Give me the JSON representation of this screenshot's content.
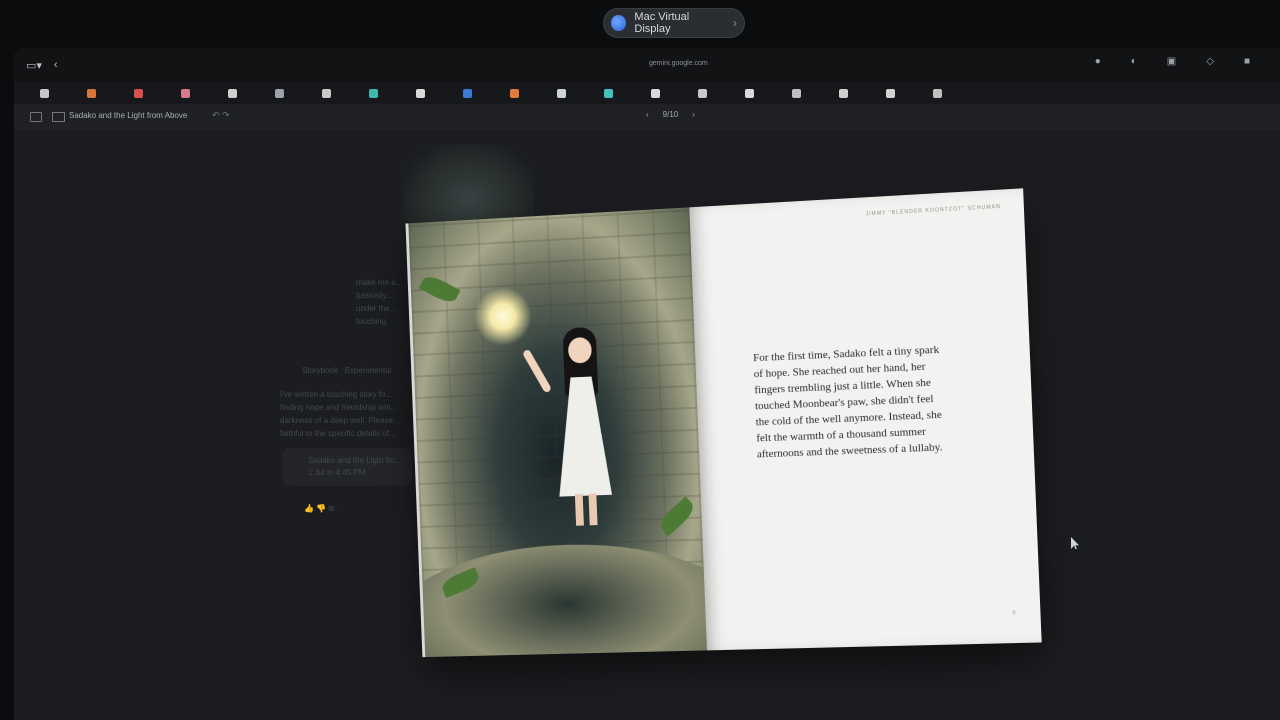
{
  "virtual_display": {
    "label": "Mac Virtual Display",
    "chevron": "›"
  },
  "browser": {
    "url": "gemini.google.com",
    "nav_back": "‹",
    "right_icons": [
      "●",
      "◐",
      "▣",
      "◇",
      "■"
    ],
    "bookmark_colors": [
      "#c7c7c7",
      "#d7763a",
      "#d94f4f",
      "#d77a8f",
      "#d0d0d0",
      "#9ca3ab",
      "#c9c9c9",
      "#3ab9b0",
      "#d8d8d8",
      "#3a7bd5",
      "#e07b39",
      "#cfd3d8",
      "#44c2c2",
      "#dadada",
      "#c8c8c8",
      "#d9d9d9",
      "#bfbfbf",
      "#cfcfcf",
      "#d2d2d2",
      "#c0c0c0"
    ]
  },
  "doc": {
    "title": "Sadako and the Light from Above",
    "pager": {
      "prev": "‹",
      "label": "9/10",
      "next": "›"
    }
  },
  "background_chat": {
    "prompt_lines": [
      "make me a...",
      "basically...",
      "under the...",
      "touching."
    ],
    "badge": "Storybook",
    "badge2": "Experimental",
    "reply_lines": [
      "I've written a touching story fo...",
      "finding hope and friendship whi...",
      "darkness of a deep well. Please ...",
      "faithful to the specific details of..."
    ],
    "card_title": "Sadako and the Light fro...",
    "card_sub": "1 Jul in 4:45 PM"
  },
  "book": {
    "running_head": "JIMMY \"BLENDER KOONTZOT\" SCHUMAN",
    "story_text": "For the first time, Sadako felt a tiny spark of hope. She reached out her hand, her fingers trembling just a little. When she touched Moonbear's paw, she didn't feel the cold of the well anymore. Instead, she felt the warmth of a thousand summer afternoons and the sweetness of a lullaby.",
    "page_number": "9"
  }
}
